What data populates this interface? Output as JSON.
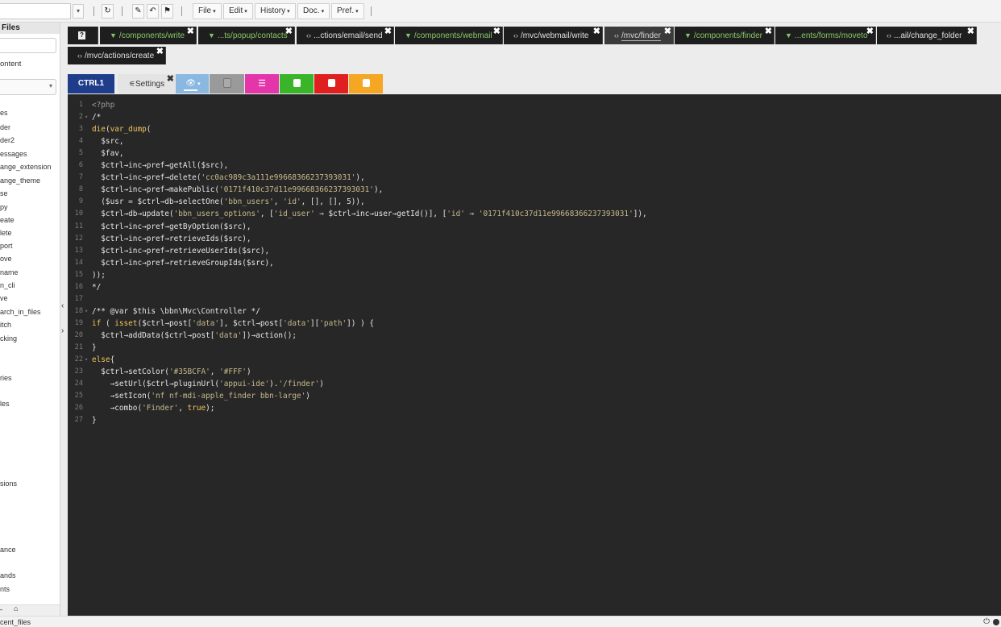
{
  "toolbar": {
    "menus": [
      {
        "label": "File"
      },
      {
        "label": "Edit"
      },
      {
        "label": "History"
      },
      {
        "label": "Doc."
      },
      {
        "label": "Pref."
      }
    ],
    "icons": [
      "refresh-icon",
      "pen-icon",
      "undo-icon",
      "flag-icon"
    ]
  },
  "sidebar": {
    "title": "Files",
    "content_label": "ontent",
    "items": [
      "es",
      "der",
      "der2",
      "essages",
      "ange_extension",
      "ange_theme",
      "se",
      "py",
      "eate",
      "lete",
      "port",
      "ove",
      "name",
      "n_cli",
      "ve",
      "arch_in_files",
      "itch",
      "cking",
      "ries",
      "les",
      "sions",
      "ance",
      "ands",
      "nts"
    ],
    "recent": "cent_files"
  },
  "tabs": [
    {
      "label": "?",
      "type": "help"
    },
    {
      "label": "/components/write",
      "type": "comp"
    },
    {
      "label": "...ts/popup/contacts",
      "type": "comp"
    },
    {
      "label": "...ctions/email/send",
      "type": "php"
    },
    {
      "label": "/components/webmail",
      "type": "comp"
    },
    {
      "label": "/mvc/webmail/write",
      "type": "php"
    },
    {
      "label": "/mvc/finder",
      "type": "php",
      "active": true
    },
    {
      "label": "/components/finder",
      "type": "comp"
    },
    {
      "label": "...ents/forms/moveto",
      "type": "comp"
    },
    {
      "label": "...ail/change_folder",
      "type": "php"
    },
    {
      "label": "/mvc/actions/create",
      "type": "php"
    }
  ],
  "subtabs": [
    {
      "label": "CTRL1",
      "color": "#1f3d8a"
    },
    {
      "label": "Settings",
      "color": "#dcdcdc"
    },
    {
      "label": "",
      "color": "#6fa8dc"
    },
    {
      "label": "",
      "color": "#9a9a9a"
    },
    {
      "label": "",
      "color": "#e535ab"
    },
    {
      "label": "",
      "color": "#3ab52a"
    },
    {
      "label": "",
      "color": "#e02020"
    },
    {
      "label": "",
      "color": "#f5a623"
    }
  ],
  "code_lines": [
    "<?php",
    "/*",
    "die(var_dump(",
    "  $src,",
    "  $fav,",
    "  $ctrl→inc→pref→getAll($src),",
    "  $ctrl→inc→pref→delete('cc0ac989c3a111e99668366237393031'),",
    "  $ctrl→inc→pref→makePublic('0171f410c37d11e99668366237393031'),",
    "  ($usr = $ctrl→db→selectOne('bbn_users', 'id', [], [], 5)),",
    "  $ctrl→db→update('bbn_users_options', ['id_user' ⇒ $ctrl→inc→user→getId()], ['id' ⇒ '0171f410c37d11e99668366237393031']),",
    "  $ctrl→inc→pref→getByOption($src),",
    "  $ctrl→inc→pref→retrieveIds($src),",
    "  $ctrl→inc→pref→retrieveUserIds($src),",
    "  $ctrl→inc→pref→retrieveGroupIds($src),",
    "));",
    "*/",
    "",
    "/** @var $this \\bbn\\Mvc\\Controller */",
    "if ( isset($ctrl→post['data'], $ctrl→post['data']['path']) ) {",
    "  $ctrl→addData($ctrl→post['data'])→action();",
    "}",
    "else{",
    "  $ctrl→setColor('#35BCFA', '#FFF')",
    "    →setUrl($ctrl→pluginUrl('appui-ide').'/finder')",
    "    →setIcon('nf nf-mdi-apple_finder bbn-large')",
    "    →combo('Finder', true);",
    "}"
  ],
  "fold_lines": [
    2,
    18,
    22
  ]
}
